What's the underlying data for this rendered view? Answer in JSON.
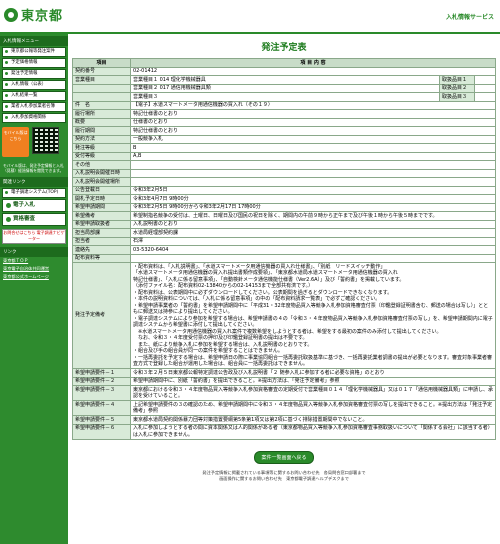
{
  "header": {
    "logo": "東京都",
    "service": "入札情報サービス"
  },
  "sidebar": {
    "menu_head": "入札情報メニュー",
    "items": [
      "東京都公報等発注案件",
      "予定価格情報",
      "発注予定情報",
      "入札情報（公表）",
      "入札結果一覧",
      "業者入札参加業者名簿",
      "入札参加資格関係"
    ],
    "mobile_label": "モバイル版はこちら",
    "mobile_note": "モバイル版は、発注予定情報と入札（見積）経過情報を閲覧できます。",
    "related_head": "関連リンク",
    "related": [
      "電子調達システム(TOP)",
      "電子入札",
      "資格審査"
    ],
    "adobe": "お問合せはこちら 電子調達ナビゲーター",
    "links": [
      "東京都ＴＯＰ",
      "東京電子自治体共同運営",
      "東京都公式ホームページ"
    ]
  },
  "page": {
    "title": "発注予定表",
    "col_item": "項目",
    "col_content": "項 目 内 容",
    "back": "案件一覧画面へ戻る",
    "footer1": "発注予定情報に掲載されている事項等に関するお問い合わせ先　各局問合窓口部署まで",
    "footer2": "画面操作に関するお問い合わせ先　東京都電子調達ヘルプデスクまで"
  },
  "rows": [
    {
      "label": "契約番号",
      "value": "02-01412"
    },
    {
      "label": "営業種目",
      "value": "営業種目１ 014 理化学機械器具",
      "extra_label": "取扱品目１",
      "extra_value": ""
    },
    {
      "label": "",
      "value": "営業種目２ 017 通信用機械器具類",
      "extra_label": "取扱品目２",
      "extra_value": ""
    },
    {
      "label": "",
      "value": "営業種目３",
      "extra_label": "取扱品目３",
      "extra_value": ""
    },
    {
      "label": "件　名",
      "value": "【電子】水道スマートメータ用通信機器の買入れ（その１９）"
    },
    {
      "label": "履行場所",
      "value": "特記仕様書のとおり"
    },
    {
      "label": "概要",
      "value": "仕様書のとおり"
    },
    {
      "label": "履行期間",
      "value": "特記仕様書のとおり"
    },
    {
      "label": "契約方法",
      "value": "一般競争入札"
    },
    {
      "label": "発注等級",
      "value": "B"
    },
    {
      "label": "受付等級",
      "value": "A,B"
    },
    {
      "label": "その他",
      "value": ""
    },
    {
      "label": "入札説明会開催日時",
      "value": ""
    },
    {
      "label": "入札説明会開催場所",
      "value": ""
    },
    {
      "label": "公告登載日",
      "value": "令和3年2月5日"
    },
    {
      "label": "開札予定日時",
      "value": "令和3年4月7日 9時00分"
    },
    {
      "label": "希望申請期間",
      "value": "令和3年2月5日 9時00分から令和3年2月17日 17時00分"
    },
    {
      "label": "希望備考",
      "value": "希望制指名競争の受付は、土曜日、日曜日及び国民の祝日を除く、期間内の午前９時から正午まで及び午後１時から午後５時までです。"
    },
    {
      "label": "希望申請取扱者",
      "value": "入札説明書のとおり"
    },
    {
      "label": "担当局部課",
      "value": "水道局経理部契約課"
    },
    {
      "label": "担当者",
      "value": "石澤"
    },
    {
      "label": "連絡先",
      "value": "03-5320-6404"
    },
    {
      "label": "配布資料等",
      "value": ""
    }
  ],
  "remarks": {
    "label": "発注予定備考",
    "lines": [
      "・配布資料は、「入札説明書」、「水道スマートメータ用通信機器の買入れ仕様書」、「別紙　リードスイッチ動作」",
      "「水道スマートメータ用通信機器の買入れ提出書類作成要領」、「東京都水道局水道スマートメータ用通信機器の買入れ",
      "特記仕様書」、「入札に係る留意事項」、「自動検針メータ通信機能仕様書（Ver2.6A）」及び「誓約書」を掲載しています。",
      "（添付ファイル名：配布資料02-13840からの02-14153まで全部共有済です。）",
      "・配布資料は、公表期間中に必ずダウンロードしてください。公表期間を過ぎるとダウンロードできなくなります。",
      "・本件の説明資料については、「入札に係る留意事項」の中の「配布資料請求一覧表」で必ずご確認ください。",
      "・希望申請事業者の「誓約書」を希望申請期間中に「平成31・32年度物品買入等競争入札参加資格審査付票（印鑑登録証明書含む、郵送の場合は写し）」とともに郵送又は持参により提出してください。",
      "・電子調達システムにより参加を希望する場合は、希望申請書の４の「令和３・４年度物品買入等競争入札参加資格審査付票の写し」を、希望申請期間内に電子調達システムから希望書に添付して提出してください。",
      "　※水道スマートメータ用通信機器の買入れ案件で複数希望をしようとする者は、希望をする最初の案件のみ添付して提出してください。",
      "　なお、令和３・４年度受付票の押印及び印鑑登録証明書の提出は不要です。",
      "　また、紙により競争入札に参加を希望する場合は、入札説明書のとおりです。",
      "・組合及び手の組合員が同一の案件を希望することはできません。",
      "・一括再委託を予定する場合は、希望申請日の際に事業協同組合一括再委託取扱基準に基づき、一括再委託業者調書の提出が必要となります。審査対象事業者審査方式で登録した組合が運用した場合は、組合員に一括再委託はできません。"
    ]
  },
  "requirements": [
    {
      "label": "希望申請要件－１",
      "value": "令和３年２月５日東京都公報特定調達公告政及び入札説明書「２ 随参入札に参加する者に必要な資格」のとおり"
    },
    {
      "label": "希望申請要件－２",
      "value": "希望申請期間中に、別紙「誓約書」を提出できること。※提出方法は、「発注予定備考」参照"
    },
    {
      "label": "希望申請要件－３",
      "value": "東京都における令和３・４年度物品買入等競争入札参加資格審査の定期受付で営業種目０１４「理化学機械器具」又は０１７「通信用機械器具類」に申請し、承認を受けていること。"
    },
    {
      "label": "希望申請要件－４",
      "value": "上記希望申請要件の３の確認のため、希望申請期間中に令和３・４年度物品買入等競争入札参加資格審査付票の写しを提出できること。※提出方法は「発注予定備考」参照"
    },
    {
      "label": "希望申請要件－５",
      "value": "東京都水道局契約関係暴力団等対策措置要綱第5条第1項又は第2項に基づく排除措置期間中でないこと。"
    },
    {
      "label": "希望申請要件－６",
      "value": "入札に参加しようとする者の間に資本関係又は人的関係がある者（東京都物品買入等競争入札参加資格審査事務取扱いについて「関係する会社」に該当する者）は入札に参加できません。"
    }
  ]
}
